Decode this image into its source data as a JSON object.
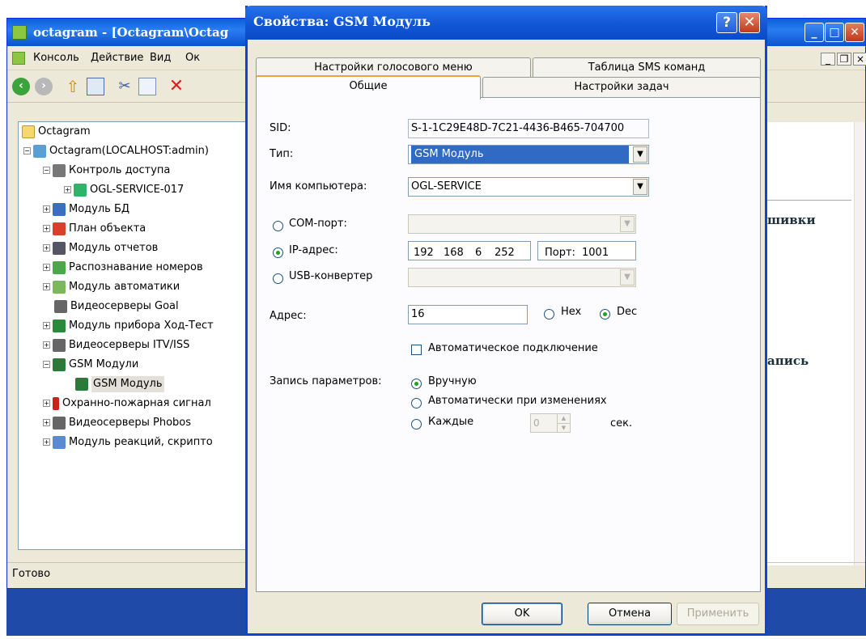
{
  "main_window": {
    "title": "octagram - [Octagram\\Octag",
    "menu": [
      "Консоль",
      "Действие",
      "Вид",
      "Ок"
    ],
    "tree": [
      {
        "label": "Octagram",
        "icon": "folder-icon"
      },
      {
        "label": "Octagram(LOCALHOST:admin)",
        "icon": "server-icon"
      },
      {
        "label": "Контроль доступа",
        "icon": "lock-icon"
      },
      {
        "label": "OGL-SERVICE-017",
        "icon": "device-icon"
      },
      {
        "label": "Модуль БД",
        "icon": "database-icon"
      },
      {
        "label": "План объекта",
        "icon": "plan-icon"
      },
      {
        "label": "Модуль отчетов",
        "icon": "report-icon"
      },
      {
        "label": "Распознавание номеров",
        "icon": "recognition-icon"
      },
      {
        "label": "Модуль автоматики",
        "icon": "automation-icon"
      },
      {
        "label": "Видеосерверы Goal",
        "icon": "camera-icon"
      },
      {
        "label": "Модуль прибора Ход-Тест",
        "icon": "meter-icon"
      },
      {
        "label": "Видеосерверы ITV/ISS",
        "icon": "camera-icon"
      },
      {
        "label": "GSM Модули",
        "icon": "phone-icon"
      },
      {
        "label": "GSM Модуль",
        "icon": "phone-icon"
      },
      {
        "label": "Охранно-пожарная сигнал",
        "icon": "alarm-icon"
      },
      {
        "label": "Видеосерверы Phobos",
        "icon": "camera-icon"
      },
      {
        "label": "Модуль реакций, скрипто",
        "icon": "script-icon"
      }
    ],
    "right_text": [
      "шивки",
      "апись"
    ],
    "status": "Готово"
  },
  "dialog": {
    "title": "Свойства: GSM Модуль",
    "tabs_back": [
      "Настройки голосового меню",
      "Таблица SMS команд"
    ],
    "tabs_front": [
      "Общие",
      "Настройки задач"
    ],
    "sid_label": "SID:",
    "sid_value": "S-1-1C29E48D-7C21-4436-B465-704700",
    "type_label": "Тип:",
    "type_value": "GSM Модуль",
    "computer_label": "Имя компьютера:",
    "computer_value": "OGL-SERVICE",
    "com_label": "COM-порт:",
    "ip_label": "IP-адрес:",
    "ip": [
      "192",
      "168",
      "6",
      "252"
    ],
    "port_label": "Порт:",
    "port_value": "1001",
    "usb_label": "USB-конвертер",
    "address_label": "Адрес:",
    "address_value": "16",
    "hex_label": "Hex",
    "dec_label": "Dec",
    "auto_connect_label": "Автоматическое подключение",
    "write_params_label": "Запись параметров:",
    "manual_label": "Вручную",
    "auto_changes_label": "Автоматически при изменениях",
    "every_label": "Каждые",
    "every_value": "0",
    "sec_label": "сек.",
    "ok": "OK",
    "cancel": "Отмена",
    "apply": "Применить"
  }
}
